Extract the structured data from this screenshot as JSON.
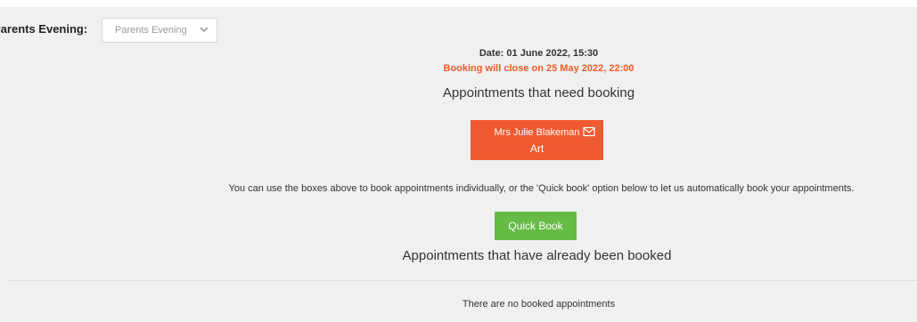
{
  "selector": {
    "label": "Parents Evening:",
    "value": "Parents Evening"
  },
  "event": {
    "date_line": "Date: 01 June 2022, 15:30",
    "booking_close": "Booking will close on 25 May 2022, 22:00",
    "booking_close_color": "#f05a28"
  },
  "need_booking": {
    "heading": "Appointments that need booking",
    "teachers": [
      {
        "name": "Mrs Julie Blakeman",
        "subject": "Art",
        "icon": "mail-icon",
        "color": "#f05a30"
      }
    ]
  },
  "instructions": "You can use the boxes above to book appointments individually, or the 'Quick book' option below to let us automatically book your appointments.",
  "quick_book": {
    "label": "Quick Book",
    "color": "#66bb46"
  },
  "booked": {
    "heading": "Appointments that have already been booked",
    "empty_message": "There are no booked appointments"
  }
}
